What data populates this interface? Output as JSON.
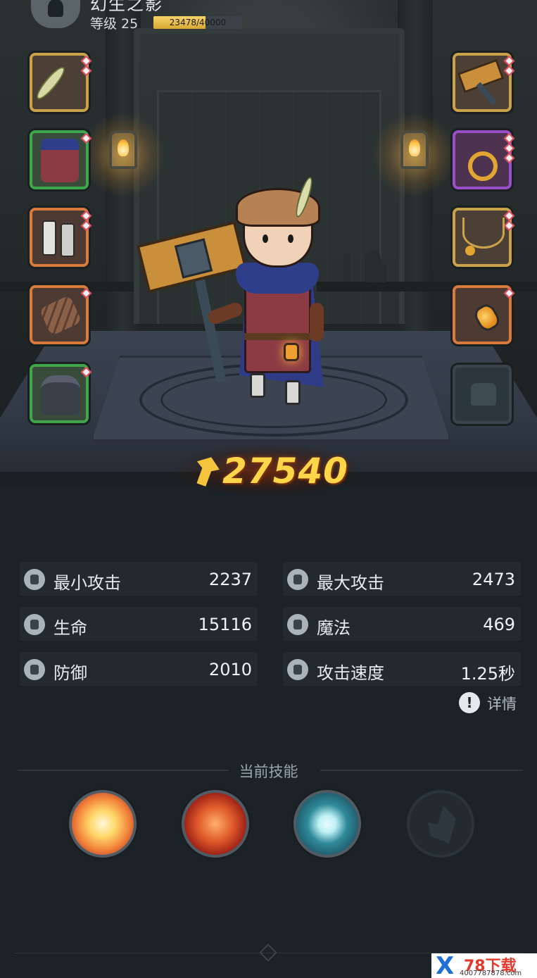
{
  "header": {
    "player_name": "幻生之影",
    "level_label": "等级 25",
    "exp_text": "23478/40000",
    "exp_fraction": 0.587
  },
  "equipment": {
    "left": [
      {
        "slot": "hat",
        "rarity": "gold",
        "icon": "feather-icon"
      },
      {
        "slot": "armor",
        "rarity": "green",
        "icon": "tunic-icon"
      },
      {
        "slot": "boots",
        "rarity": "orange",
        "icon": "boots-icon"
      },
      {
        "slot": "bracer",
        "rarity": "orange",
        "icon": "bracer-icon"
      },
      {
        "slot": "cloak",
        "rarity": "green",
        "icon": "cloak-icon"
      }
    ],
    "right": [
      {
        "slot": "weapon",
        "rarity": "gold",
        "icon": "hammer-icon"
      },
      {
        "slot": "ring",
        "rarity": "purple",
        "icon": "ring-icon"
      },
      {
        "slot": "necklace",
        "rarity": "gold",
        "icon": "necklace-icon"
      },
      {
        "slot": "charm",
        "rarity": "orange",
        "icon": "amber-charm-icon"
      }
    ]
  },
  "combat_power": "27540",
  "stats": [
    {
      "label": "最小攻击",
      "value": "2237",
      "icon": "sword-icon"
    },
    {
      "label": "最大攻击",
      "value": "2473",
      "icon": "sword-icon"
    },
    {
      "label": "生命",
      "value": "15116",
      "icon": "heart-icon"
    },
    {
      "label": "魔法",
      "value": "469",
      "icon": "magic-icon"
    },
    {
      "label": "防御",
      "value": "2010",
      "icon": "shield-icon"
    },
    {
      "label": "攻击速度",
      "value": "1.25秒",
      "icon": "speed-icon"
    }
  ],
  "details_label": "详情",
  "skills": {
    "title": "当前技能",
    "items": [
      {
        "icon": "burst-skill-icon"
      },
      {
        "icon": "fire-vortex-skill-icon"
      },
      {
        "icon": "frost-orb-skill-icon"
      },
      {
        "icon": "locked-skill-icon"
      }
    ]
  },
  "watermark": {
    "logo": "X",
    "brand": "78下载",
    "url": "4007787878.com"
  },
  "colors": {
    "gold": "#c9a24a",
    "green": "#3fa64c",
    "orange": "#d77a3b",
    "purple": "#9b4ec7",
    "power": "#ffd54a"
  }
}
